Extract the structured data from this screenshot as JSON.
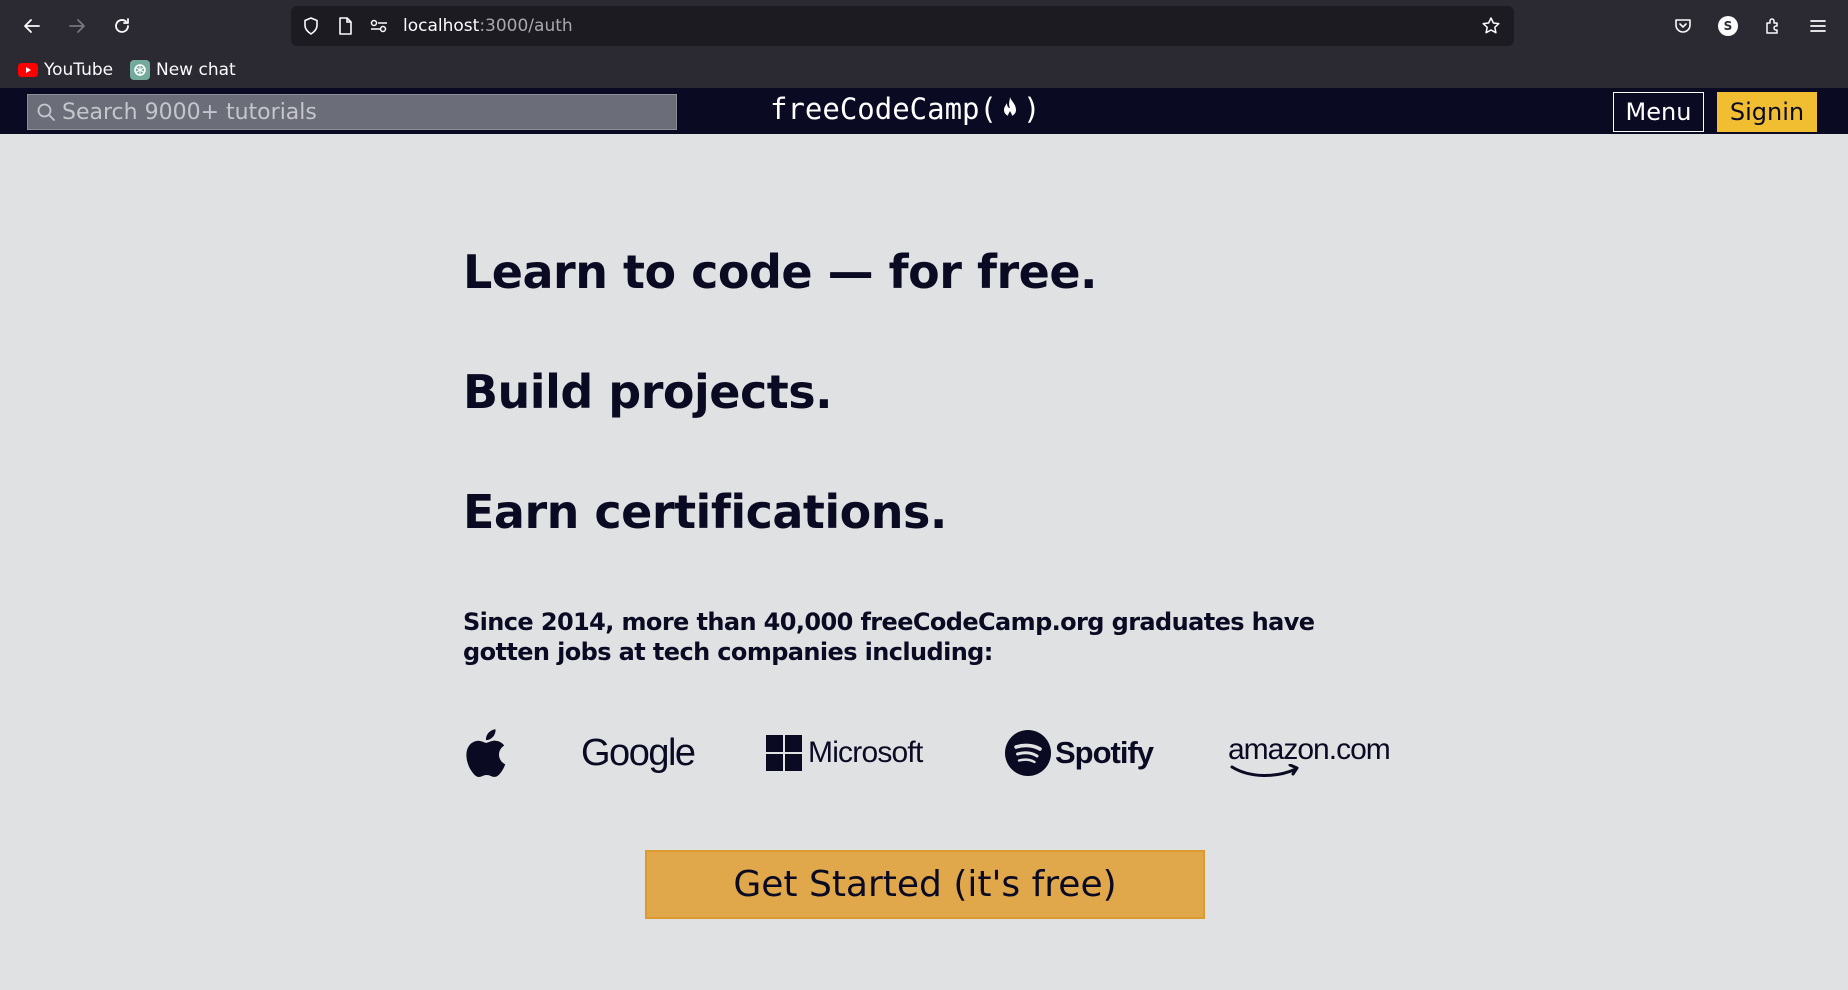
{
  "browser": {
    "url_host": "localhost",
    "url_path": ":3000/auth",
    "profile_initial": "S",
    "bookmarks": [
      {
        "label": "YouTube",
        "icon": "youtube-icon"
      },
      {
        "label": "New chat",
        "icon": "chatgpt-icon"
      }
    ]
  },
  "navbar": {
    "search_placeholder": "Search 9000+ tutorials",
    "brand_prefix": "freeCodeCamp(",
    "brand_suffix": ")",
    "menu_label": "Menu",
    "signin_label": "Signin"
  },
  "hero": {
    "headline_1": "Learn to code — for free.",
    "headline_2": "Build projects.",
    "headline_3": "Earn certifications.",
    "subtext": "Since 2014, more than 40,000 freeCodeCamp.org graduates have gotten jobs at tech companies including:",
    "companies": [
      "Apple",
      "Google",
      "Microsoft",
      "Spotify",
      "amazon.com"
    ],
    "cta_label": "Get Started (it's free)"
  },
  "colors": {
    "page_background": "#dfe1e3",
    "navbar_background": "#0a0a23",
    "accent_yellow": "#f1be32",
    "cta_background": "#e0a84b"
  }
}
